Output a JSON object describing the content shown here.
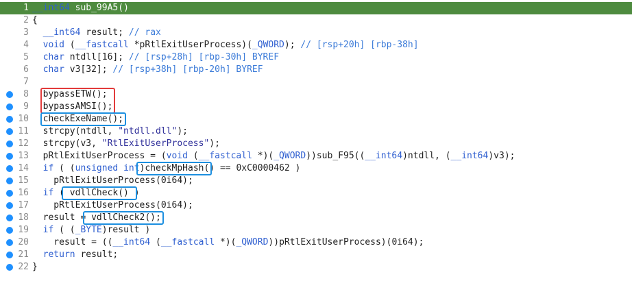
{
  "lines": [
    {
      "n": "1",
      "text": "__int64 sub_99A5()"
    },
    {
      "n": "2",
      "text": "{"
    },
    {
      "n": "3",
      "text": "  __int64 result; // rax"
    },
    {
      "n": "4",
      "text": "  void (__fastcall *pRtlExitUserProcess)(_QWORD); // [rsp+20h] [rbp-38h]"
    },
    {
      "n": "5",
      "text": "  char ntdll[16]; // [rsp+28h] [rbp-30h] BYREF"
    },
    {
      "n": "6",
      "text": "  char v3[32]; // [rsp+38h] [rbp-20h] BYREF"
    },
    {
      "n": "7",
      "text": ""
    },
    {
      "n": "8",
      "text": "  bypassETW();"
    },
    {
      "n": "9",
      "text": "  bypassAMSI();"
    },
    {
      "n": "10",
      "text": "  checkExeName();"
    },
    {
      "n": "11",
      "text": "  strcpy(ntdll, \"ntdll.dll\");"
    },
    {
      "n": "12",
      "text": "  strcpy(v3, \"RtlExitUserProcess\");"
    },
    {
      "n": "13",
      "text": "  pRtlExitUserProcess = (void (__fastcall *)(_QWORD))sub_F95((__int64)ntdll, (__int64)v3);"
    },
    {
      "n": "14",
      "text": "  if ( (unsigned int)checkMpHash() == 0xC0000462 )"
    },
    {
      "n": "15",
      "text": "    pRtlExitUserProcess(0i64);"
    },
    {
      "n": "16",
      "text": "  if ( vdllCheck() )"
    },
    {
      "n": "17",
      "text": "    pRtlExitUserProcess(0i64);"
    },
    {
      "n": "18",
      "text": "  result = vdllCheck2();"
    },
    {
      "n": "19",
      "text": "  if ( (_BYTE)result )"
    },
    {
      "n": "20",
      "text": "    result = ((__int64 (__fastcall *)(_QWORD))pRtlExitUserProcess)(0i64);"
    },
    {
      "n": "21",
      "text": "  return result;"
    },
    {
      "n": "22",
      "text": "}"
    }
  ],
  "breakpoint_lines": [
    "8",
    "9",
    "10",
    "11",
    "12",
    "13",
    "14",
    "15",
    "16",
    "17",
    "18",
    "19",
    "20",
    "21",
    "22"
  ],
  "highlighted_line": "1",
  "colors": {
    "highlight": "#4e8b3f",
    "breakpoint": "#1e90ff",
    "red_box": "#e23b3b",
    "blue_box": "#1c8fe0"
  }
}
